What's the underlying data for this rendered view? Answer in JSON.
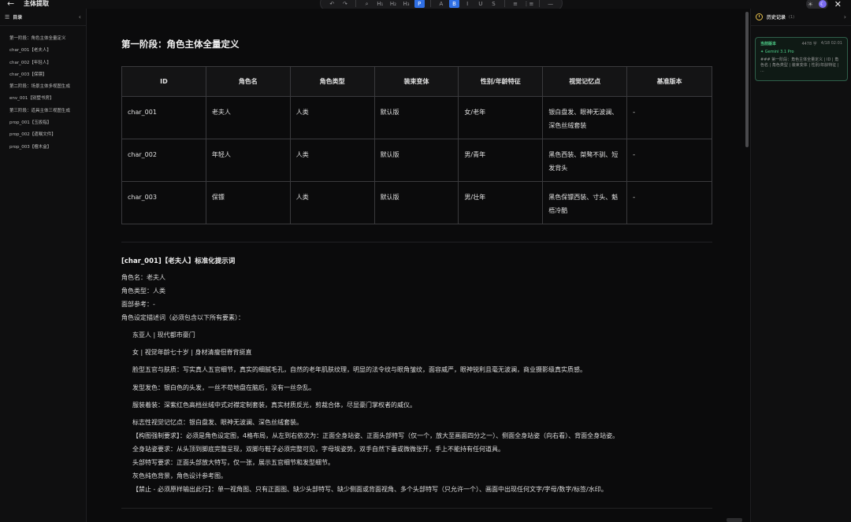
{
  "app": {
    "title": "主体提取"
  },
  "toolbar": {
    "items": [
      "↶",
      "↷",
      "⌕",
      "H₁",
      "H₂",
      "H₃",
      "P",
      "A",
      "B",
      "I",
      "U",
      "S",
      "≡",
      "⋮≡",
      "—"
    ]
  },
  "sidebar": {
    "title": "目录",
    "items": [
      "第一阶段：角色主体全量定义",
      "char_001【老夫人】",
      "char_002【年轻人】",
      "char_003【保镖】",
      "第二阶段：场景主体多视图生成",
      "env_001【别墅书房】",
      "第三阶段：道具主体三视图生成",
      "prop_001【玉扳指】",
      "prop_002【遗嘱文件】",
      "prop_003【檀木盒】"
    ]
  },
  "main": {
    "heading": "第一阶段：角色主体全量定义",
    "table": {
      "headers": [
        "ID",
        "角色名",
        "角色类型",
        "装束变体",
        "性别/年龄特征",
        "视觉记忆点",
        "基准版本"
      ],
      "rows": [
        [
          "char_001",
          "老夫人",
          "人类",
          "默认版",
          "女/老年",
          "银白盘发、眼神无波澜、深色丝绒套装",
          "-"
        ],
        [
          "char_002",
          "年轻人",
          "人类",
          "默认版",
          "男/青年",
          "黑色西装、桀骜不驯、短发背头",
          "-"
        ],
        [
          "char_003",
          "保镖",
          "人类",
          "默认版",
          "男/壮年",
          "黑色保镖西装、寸头、魁梧冷酷",
          "-"
        ]
      ]
    },
    "section_title": "[char_001]【老夫人】标准化提示词",
    "lines": [
      "角色名：老夫人",
      "角色类型：人类",
      "面部参考：-",
      "角色设定描述词（必须包含以下所有要素）："
    ],
    "indented": [
      "东亚人 | 现代都市豪门",
      "女 | 视觉年龄七十岁 | 身材清瘦但脊背挺直",
      "脸型五官与肤质：写实真人五官细节，真实的细腻毛孔，自然的老年肌肤纹理，明显的法令纹与眼角皱纹，面容威严，眼神锐利且毫无波澜，商业摄影级真实质感。",
      "发型发色：银白色的头发，一丝不苟地盘在脑后，没有一丝杂乱。",
      "服装着装：深紫红色高档丝绒中式对襟定制套装，真实材质反光，剪裁合体，尽显豪门掌权者的威仪。",
      "标志性视觉记忆点：银白盘发、眼神无波澜、深色丝绒套装。",
      "【构图强制要求】：必须是角色设定图，4格布局，从左到右依次为：正面全身站姿、正面头部特写（仅一个，放大至画面四分之一）、侧面全身站姿（向右看）、背面全身站姿。",
      "全身站姿要求：从头顶到脚底完整呈现，双脚与鞋子必须完整可见，字母埃姿势，双手自然下垂或微微张开，手上不能持有任何道具。",
      "头部特写要求：正面头部放大特写，仅一张，展示五官细节和发型细节。",
      "灰色纯色背景，角色设计参考图。",
      "【禁止 - 必须原样输出此行】：单一视角图、只有正面图、缺少头部特写、缺少侧面或背面视角、多个头部特写（只允许一个）、画面中出现任何文字/字母/数字/标签/水印。"
    ]
  },
  "history": {
    "title": "历史记录",
    "count": "(1)",
    "version": {
      "label": "当前版本",
      "size": "4478 字",
      "time": "4/18 02:01",
      "model": "Gemini 3.1 Pro",
      "preview": "### 第一阶段：角色主体全量定义 | ID | 角色名 | 角色类型 | 装束变体 | 性别/年龄特征 | ..."
    }
  }
}
